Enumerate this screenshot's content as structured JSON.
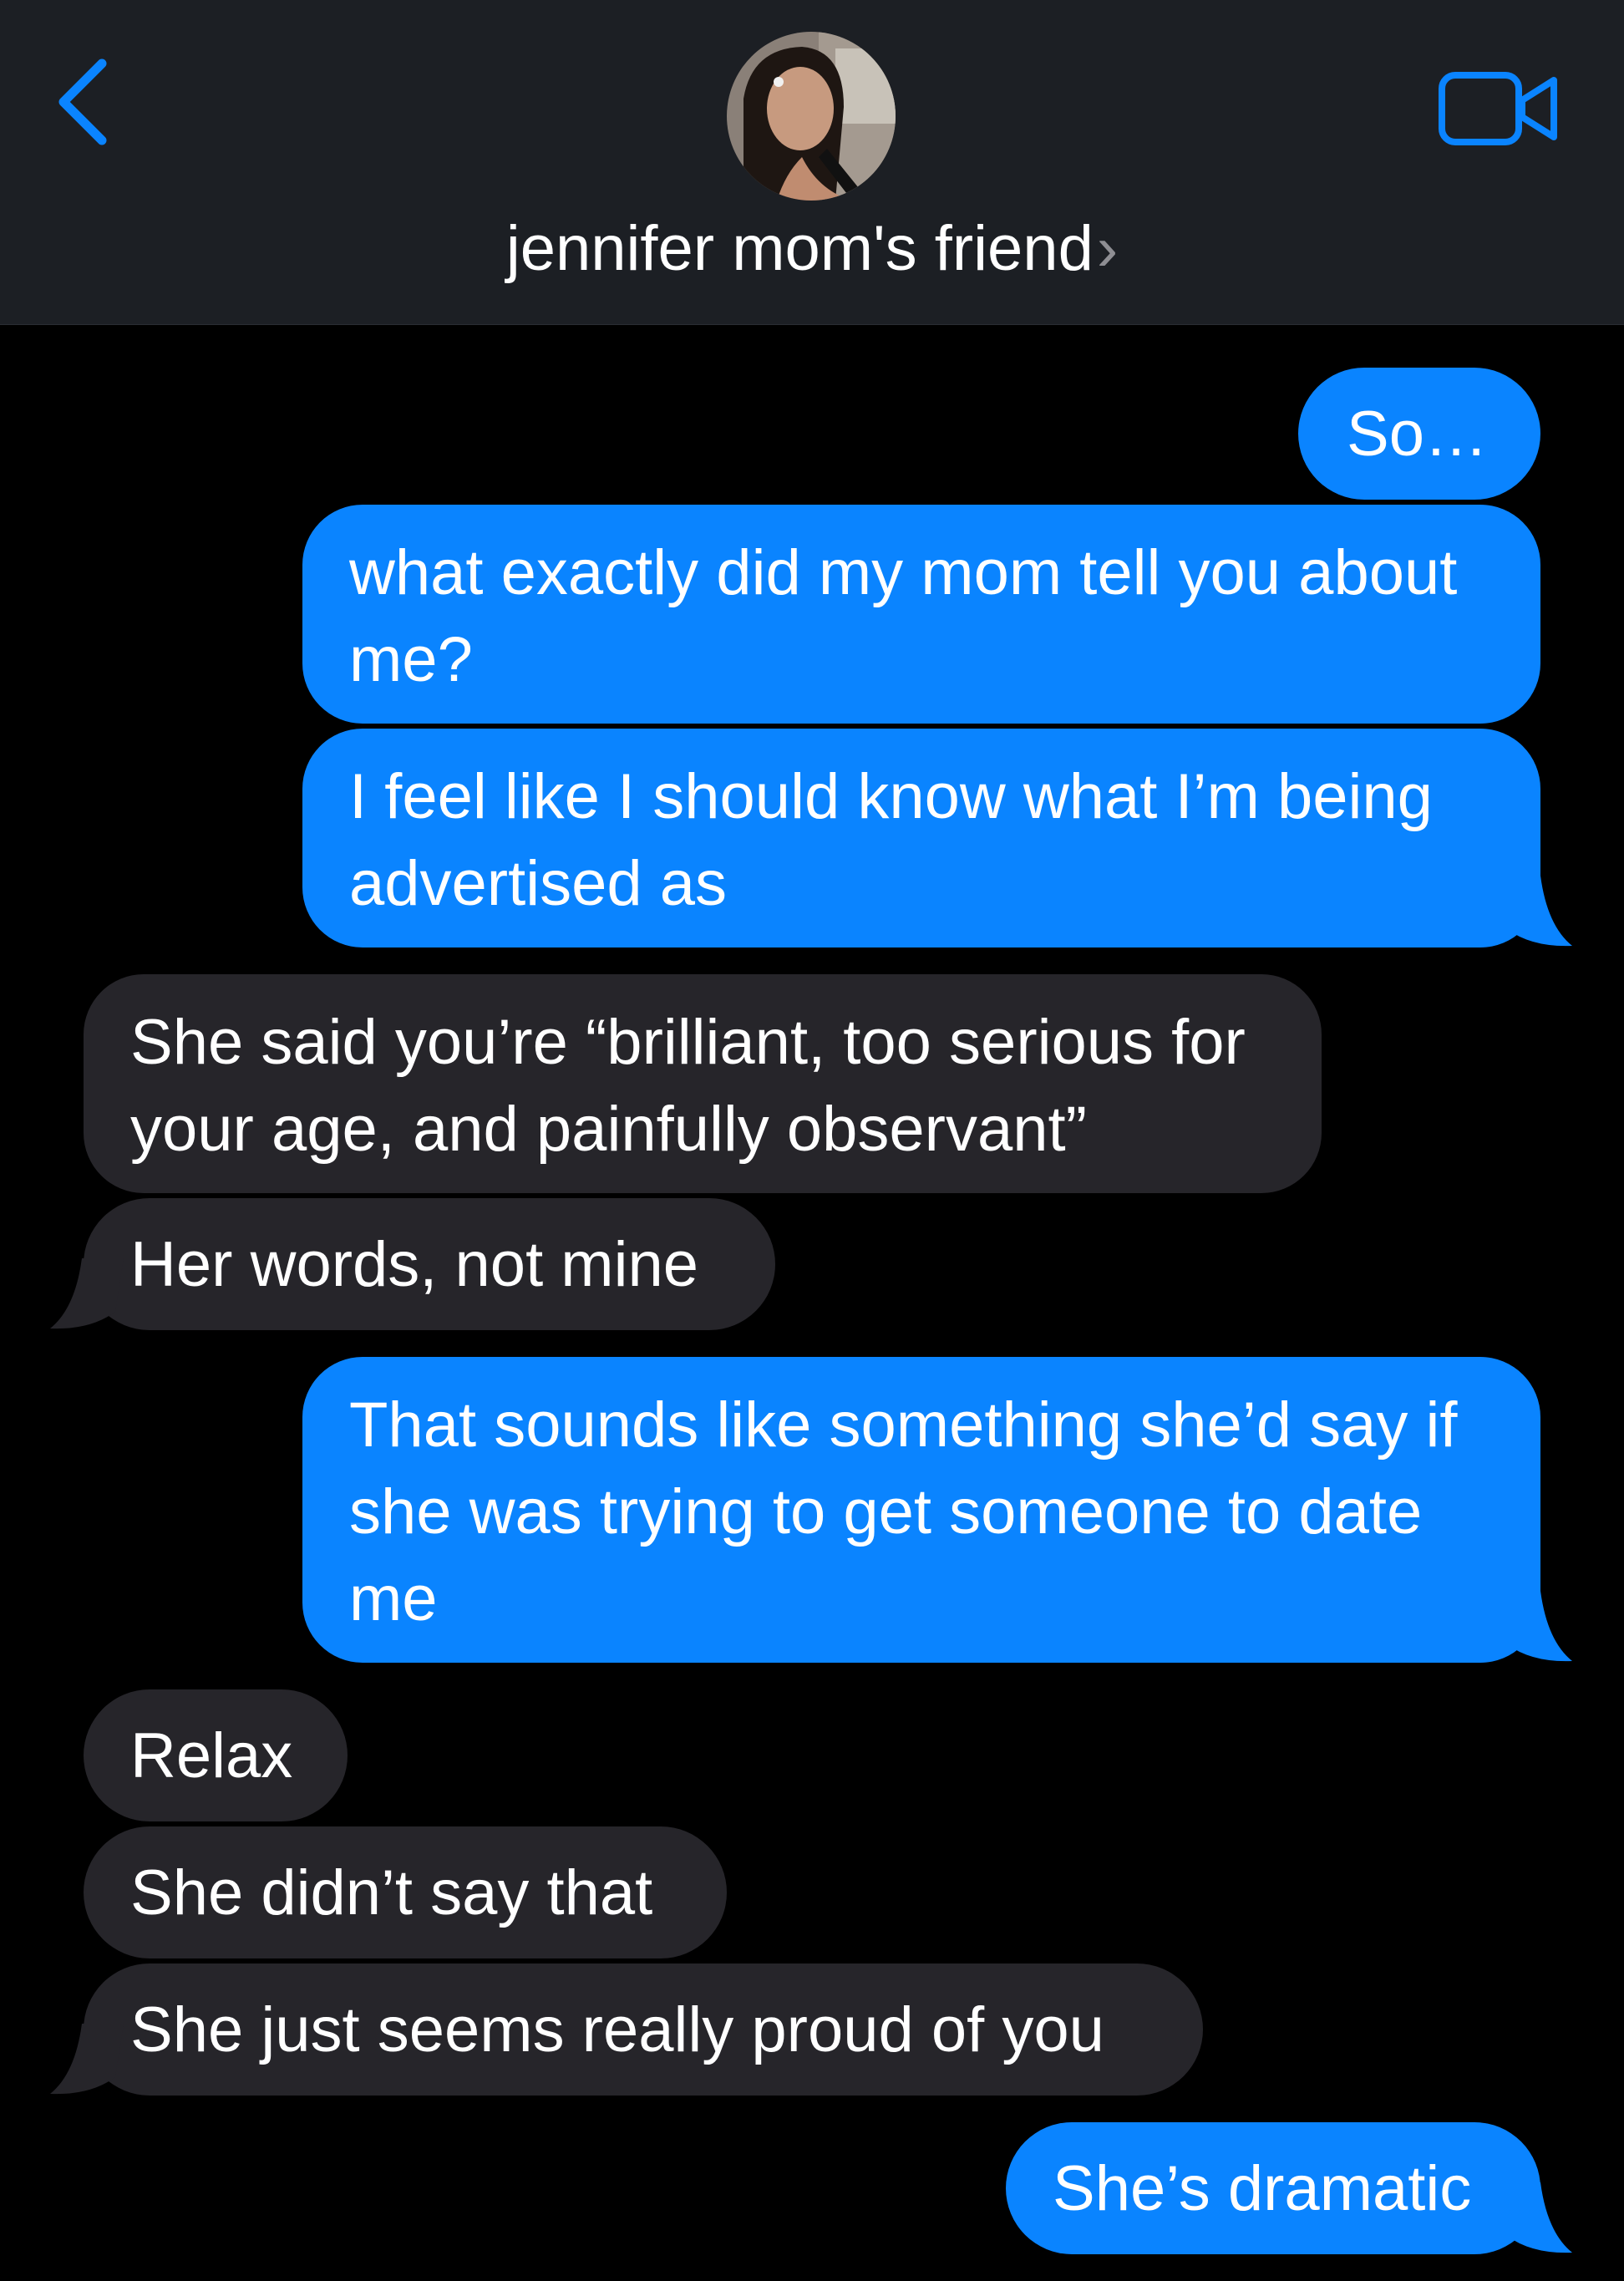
{
  "header": {
    "contact_name": "jennifer mom's friend",
    "chevron": "›",
    "back_icon": "chevron-left-icon",
    "video_icon": "video-camera-icon",
    "accent_color": "#0a84ff"
  },
  "colors": {
    "sent_bubble": "#0a84ff",
    "received_bubble": "#26252a",
    "background": "#000000",
    "header_background": "#1c1f24"
  },
  "messages": [
    {
      "direction": "sent",
      "text": "So…"
    },
    {
      "direction": "sent",
      "text": "what exactly did my mom tell you about me?"
    },
    {
      "direction": "sent",
      "text": "I feel like I should know what I’m being advertised as"
    },
    {
      "direction": "received",
      "text": "She said you’re “brilliant, too serious for your age, and painfully observant”"
    },
    {
      "direction": "received",
      "text": "Her words, not mine"
    },
    {
      "direction": "sent",
      "text": "That sounds like something she’d say if she was trying to get someone to date me"
    },
    {
      "direction": "received",
      "text": "Relax"
    },
    {
      "direction": "received",
      "text": "She didn’t say that"
    },
    {
      "direction": "received",
      "text": "She just seems really proud of you"
    },
    {
      "direction": "sent",
      "text": "She’s dramatic"
    }
  ]
}
